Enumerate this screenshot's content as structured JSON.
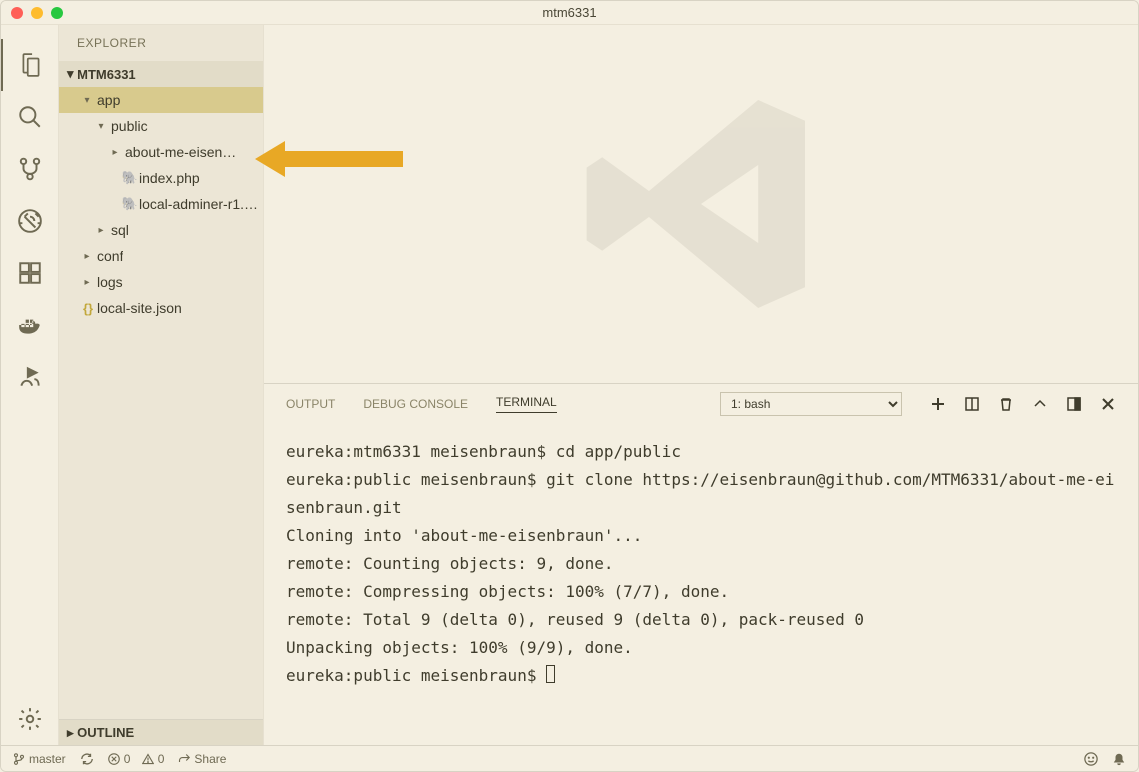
{
  "window": {
    "title": "mtm6331"
  },
  "sidebar": {
    "title": "EXPLORER",
    "workspace": "MTM6331",
    "outline": "OUTLINE",
    "tree": [
      {
        "label": "app",
        "indent": 0,
        "chev": "▾",
        "icon": "",
        "sel": true
      },
      {
        "label": "public",
        "indent": 1,
        "chev": "▾",
        "icon": "",
        "sel": false
      },
      {
        "label": "about-me-eisen…",
        "indent": 2,
        "chev": "▸",
        "icon": "",
        "sel": false
      },
      {
        "label": "index.php",
        "indent": 2,
        "chev": "",
        "icon": "php",
        "sel": false
      },
      {
        "label": "local-adminer-r1.…",
        "indent": 2,
        "chev": "",
        "icon": "php",
        "sel": false
      },
      {
        "label": "sql",
        "indent": 1,
        "chev": "▸",
        "icon": "",
        "sel": false
      },
      {
        "label": "conf",
        "indent": 0,
        "chev": "▸",
        "icon": "",
        "sel": false
      },
      {
        "label": "logs",
        "indent": 0,
        "chev": "▸",
        "icon": "",
        "sel": false
      },
      {
        "label": "local-site.json",
        "indent": -1,
        "chev": "",
        "icon": "json",
        "sel": false
      }
    ]
  },
  "panel": {
    "tabs": [
      "OUTPUT",
      "DEBUG CONSOLE",
      "TERMINAL"
    ],
    "active_tab": "TERMINAL",
    "shell_select": "1: bash",
    "lines": [
      "eureka:mtm6331 meisenbraun$ cd app/public",
      "eureka:public meisenbraun$ git clone https://eisenbraun@github.com/MTM6331/about-me-eisenbraun.git",
      "Cloning into 'about-me-eisenbraun'...",
      "remote: Counting objects: 9, done.",
      "remote: Compressing objects: 100% (7/7), done.",
      "remote: Total 9 (delta 0), reused 9 (delta 0), pack-reused 0",
      "Unpacking objects: 100% (9/9), done.",
      "eureka:public meisenbraun$ "
    ]
  },
  "status": {
    "branch": "master",
    "errors": "0",
    "warnings": "0",
    "share": "Share"
  }
}
